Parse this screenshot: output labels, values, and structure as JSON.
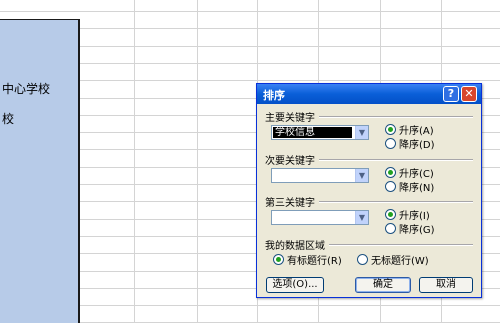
{
  "sheet": {
    "column_a_cells": [
      {
        "text": "中心学校"
      },
      {
        "text": "校"
      }
    ],
    "selection_color": "#b7cbe8"
  },
  "dialog": {
    "title": "排序",
    "help_label": "?",
    "close_label": "✕",
    "primary_key": {
      "label": "主要关键字",
      "value": "学校信息",
      "asc_label": "升序(A)",
      "desc_label": "降序(D)",
      "order": "ascending"
    },
    "secondary_key": {
      "label": "次要关键字",
      "value": "",
      "asc_label": "升序(C)",
      "desc_label": "降序(N)",
      "order": "ascending"
    },
    "tertiary_key": {
      "label": "第三关键字",
      "value": "",
      "asc_label": "升序(I)",
      "desc_label": "降序(G)",
      "order": "ascending"
    },
    "data_range": {
      "label": "我的数据区域",
      "has_header_label": "有标题行(R)",
      "no_header_label": "无标题行(W)",
      "selected": "has_header"
    },
    "options_button": "选项(O)...",
    "ok_button": "确定",
    "cancel_button": "取消",
    "title_color": "#0a5fd8",
    "close_color": "#d8462c"
  }
}
